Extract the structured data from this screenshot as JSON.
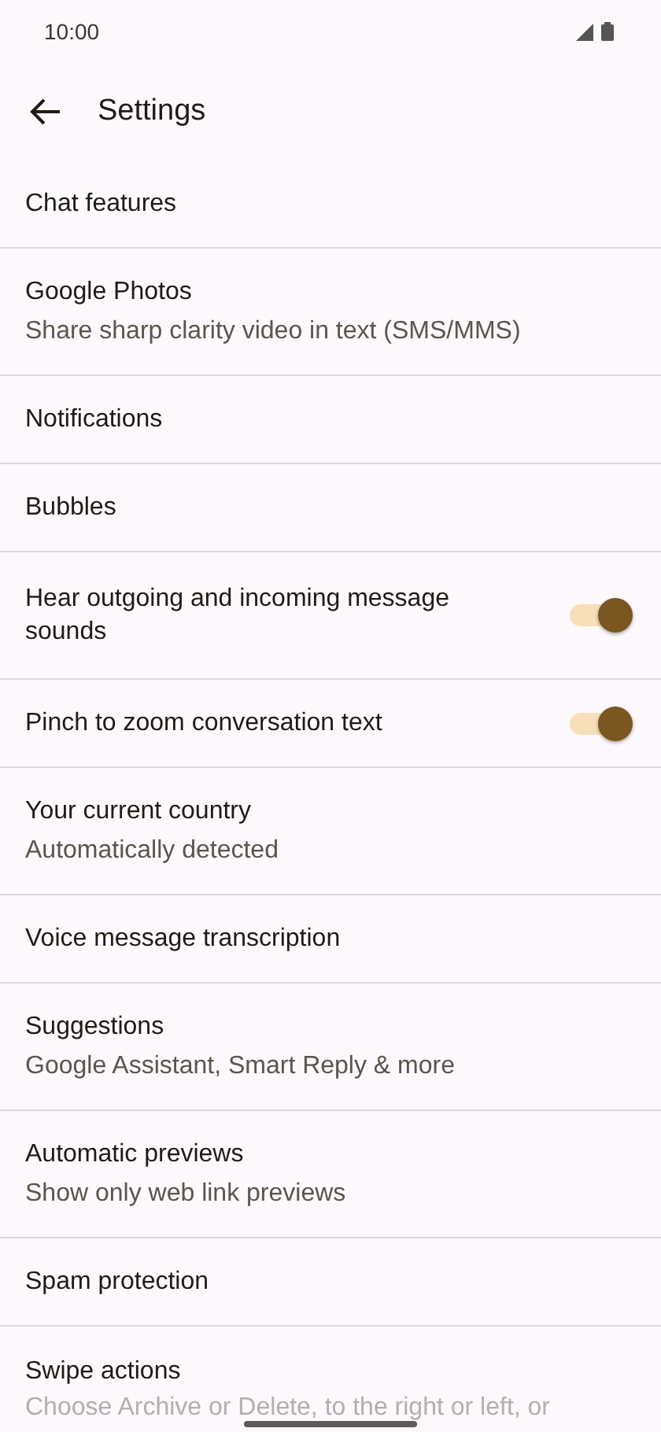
{
  "status_bar": {
    "time": "10:00"
  },
  "header": {
    "title": "Settings"
  },
  "items": [
    {
      "kind": "plain",
      "title": "Chat features"
    },
    {
      "kind": "plain",
      "title": "Google Photos",
      "subtitle": "Share sharp clarity video in text (SMS/MMS)"
    },
    {
      "kind": "plain",
      "title": "Notifications"
    },
    {
      "kind": "plain",
      "title": "Bubbles"
    },
    {
      "kind": "toggle",
      "title": "Hear outgoing and incoming message sounds",
      "on": true
    },
    {
      "kind": "toggle",
      "title": "Pinch to zoom conversation text",
      "on": true
    },
    {
      "kind": "plain",
      "title": "Your current country",
      "subtitle": "Automatically detected"
    },
    {
      "kind": "plain",
      "title": "Voice message transcription"
    },
    {
      "kind": "plain",
      "title": "Suggestions",
      "subtitle": "Google Assistant, Smart Reply & more"
    },
    {
      "kind": "plain",
      "title": "Automatic previews",
      "subtitle": "Show only web link previews"
    },
    {
      "kind": "plain",
      "title": "Spam protection"
    },
    {
      "kind": "plain",
      "title": "Swipe actions",
      "subtitle": "Choose Archive or Delete, to the right or left, or",
      "faded": true
    }
  ]
}
